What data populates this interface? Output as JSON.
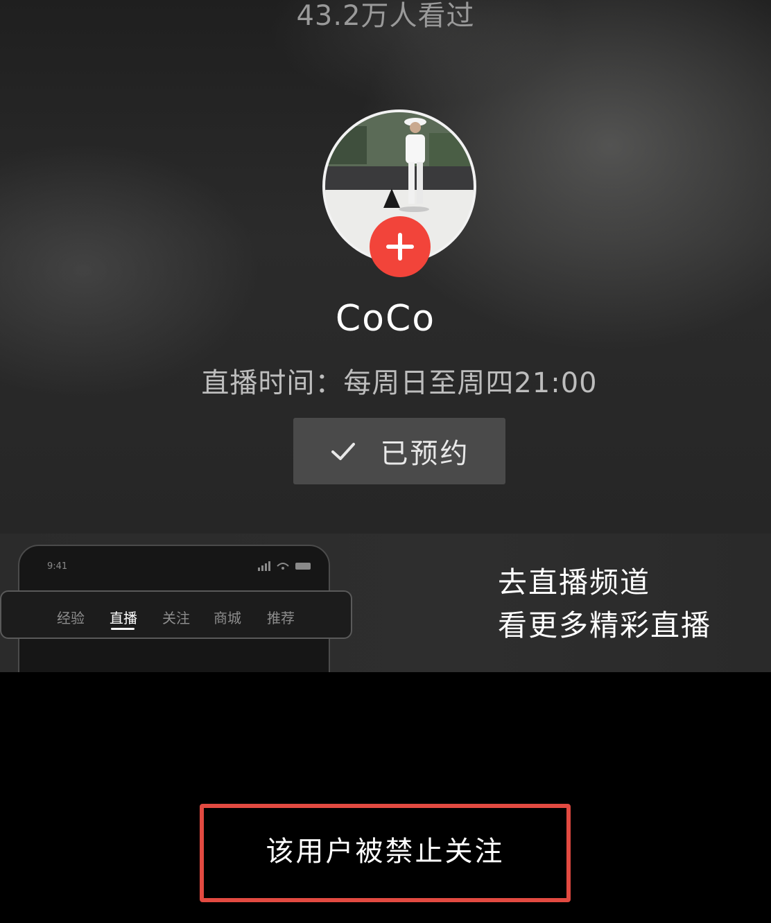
{
  "viewer_count": "43.2万人看过",
  "streamer": {
    "name": "CoCo",
    "schedule": "直播时间：每周日至周四21:00",
    "follow_icon": "plus-icon",
    "follow_color": "#f2443a"
  },
  "reservation": {
    "icon": "check-icon",
    "label": "已预约"
  },
  "promo": {
    "phone_time": "9:41",
    "tabs": [
      "经验",
      "直播",
      "关注",
      "商城",
      "推荐"
    ],
    "active_tab_index": 1,
    "line1": "去直播频道",
    "line2": "看更多精彩直播"
  },
  "notice": {
    "text": "该用户被禁止关注",
    "highlight_color": "#e24a41"
  }
}
